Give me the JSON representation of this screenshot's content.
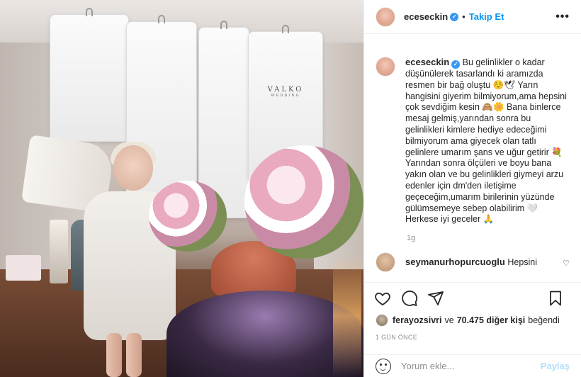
{
  "post": {
    "author": "eceseckin",
    "verified": true,
    "follow_label": "Takip Et",
    "header_separator": "•",
    "more_label": "•••",
    "photo_brand": "VALKO",
    "photo_brand_sub": "WEDDING",
    "caption": "Bu gelinlikler o kadar düşünülerek tasarlandı ki aramızda resmen bir bağ oluştu ☺️🕊 Yarın hangisini giyerim bilmiyorum,ama hepsini çok sevdiğim kesin 🙈🌼 Bana binlerce mesaj gelmiş,yarından sonra bu gelinlikleri kimlere hediye edeceğimi bilmiyorum ama giyecek olan tatlı gelinlere umarım şans ve uğur getirir 💐 Yarından sonra ölçüleri ve boyu bana yakın olan ve bu gelinlikleri giymeyi arzu edenler için dm'den iletişime geçeceğim,umarım birilerinin yüzünde gülümsemeye sebep olabilirim 🤍 Herkese iyi geceler 🙏",
    "caption_time": "1g"
  },
  "comments": [
    {
      "user": "seymanurhopurcuoglu",
      "text": "Hepsini"
    }
  ],
  "likes": {
    "first_user": "ferayozsivri",
    "joiner": "ve",
    "count_text": "70.475 diğer kişi",
    "suffix": "beğendi"
  },
  "date_label": "1 GÜN ÖNCE",
  "add_comment": {
    "placeholder": "Yorum ekle...",
    "post_label": "Paylaş"
  },
  "icons": [
    "heart-icon",
    "comment-icon",
    "share-icon",
    "bookmark-icon",
    "emoji-icon",
    "more-icon",
    "verified-icon"
  ],
  "colors": {
    "accent": "#0095f6",
    "verified": "#3897f0",
    "post_disabled": "#b2dffc"
  }
}
